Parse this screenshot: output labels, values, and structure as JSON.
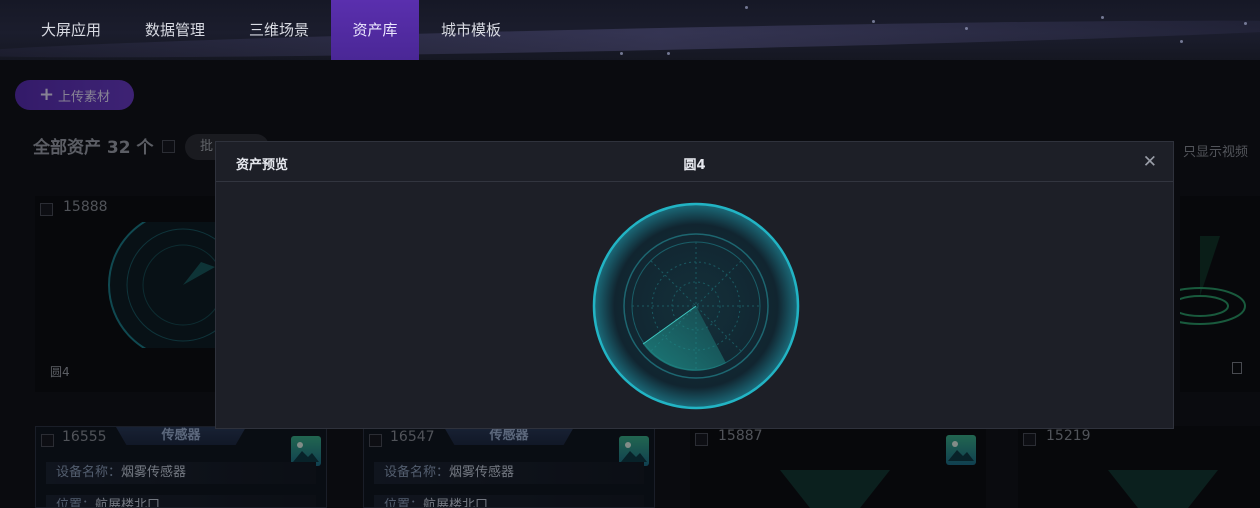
{
  "nav": {
    "items": [
      {
        "label": "大屏应用",
        "active": false
      },
      {
        "label": "数据管理",
        "active": false
      },
      {
        "label": "三维场景",
        "active": false
      },
      {
        "label": "资产库",
        "active": true
      },
      {
        "label": "城市模板",
        "active": false
      }
    ]
  },
  "toolbar": {
    "upload_label": "上传素材",
    "upload_icon": "plus-icon"
  },
  "summary": {
    "total_label": "全部资产 32 个",
    "batch_label": "批",
    "only_video_label": "只显示视频"
  },
  "cards": [
    {
      "id": "15888",
      "name": "圆4"
    },
    {
      "id": "16555",
      "header": "传感器",
      "rows": [
        {
          "key": "设备名称：",
          "value": "烟雾传感器"
        },
        {
          "key": "位置：",
          "value": "航展楼北口"
        }
      ]
    },
    {
      "id": "16547",
      "header": "传感器",
      "rows": [
        {
          "key": "设备名称：",
          "value": "烟雾传感器"
        },
        {
          "key": "位置：",
          "value": "航展楼北口"
        }
      ]
    },
    {
      "id": "15887"
    },
    {
      "id": "15219"
    }
  ],
  "modal": {
    "title": "资产预览",
    "asset_name": "圆4",
    "close_icon": "close-icon"
  },
  "colors": {
    "accent": "#5a2fae",
    "radar_teal": "#1fb3c4",
    "modal_bg": "#1d1f27"
  }
}
